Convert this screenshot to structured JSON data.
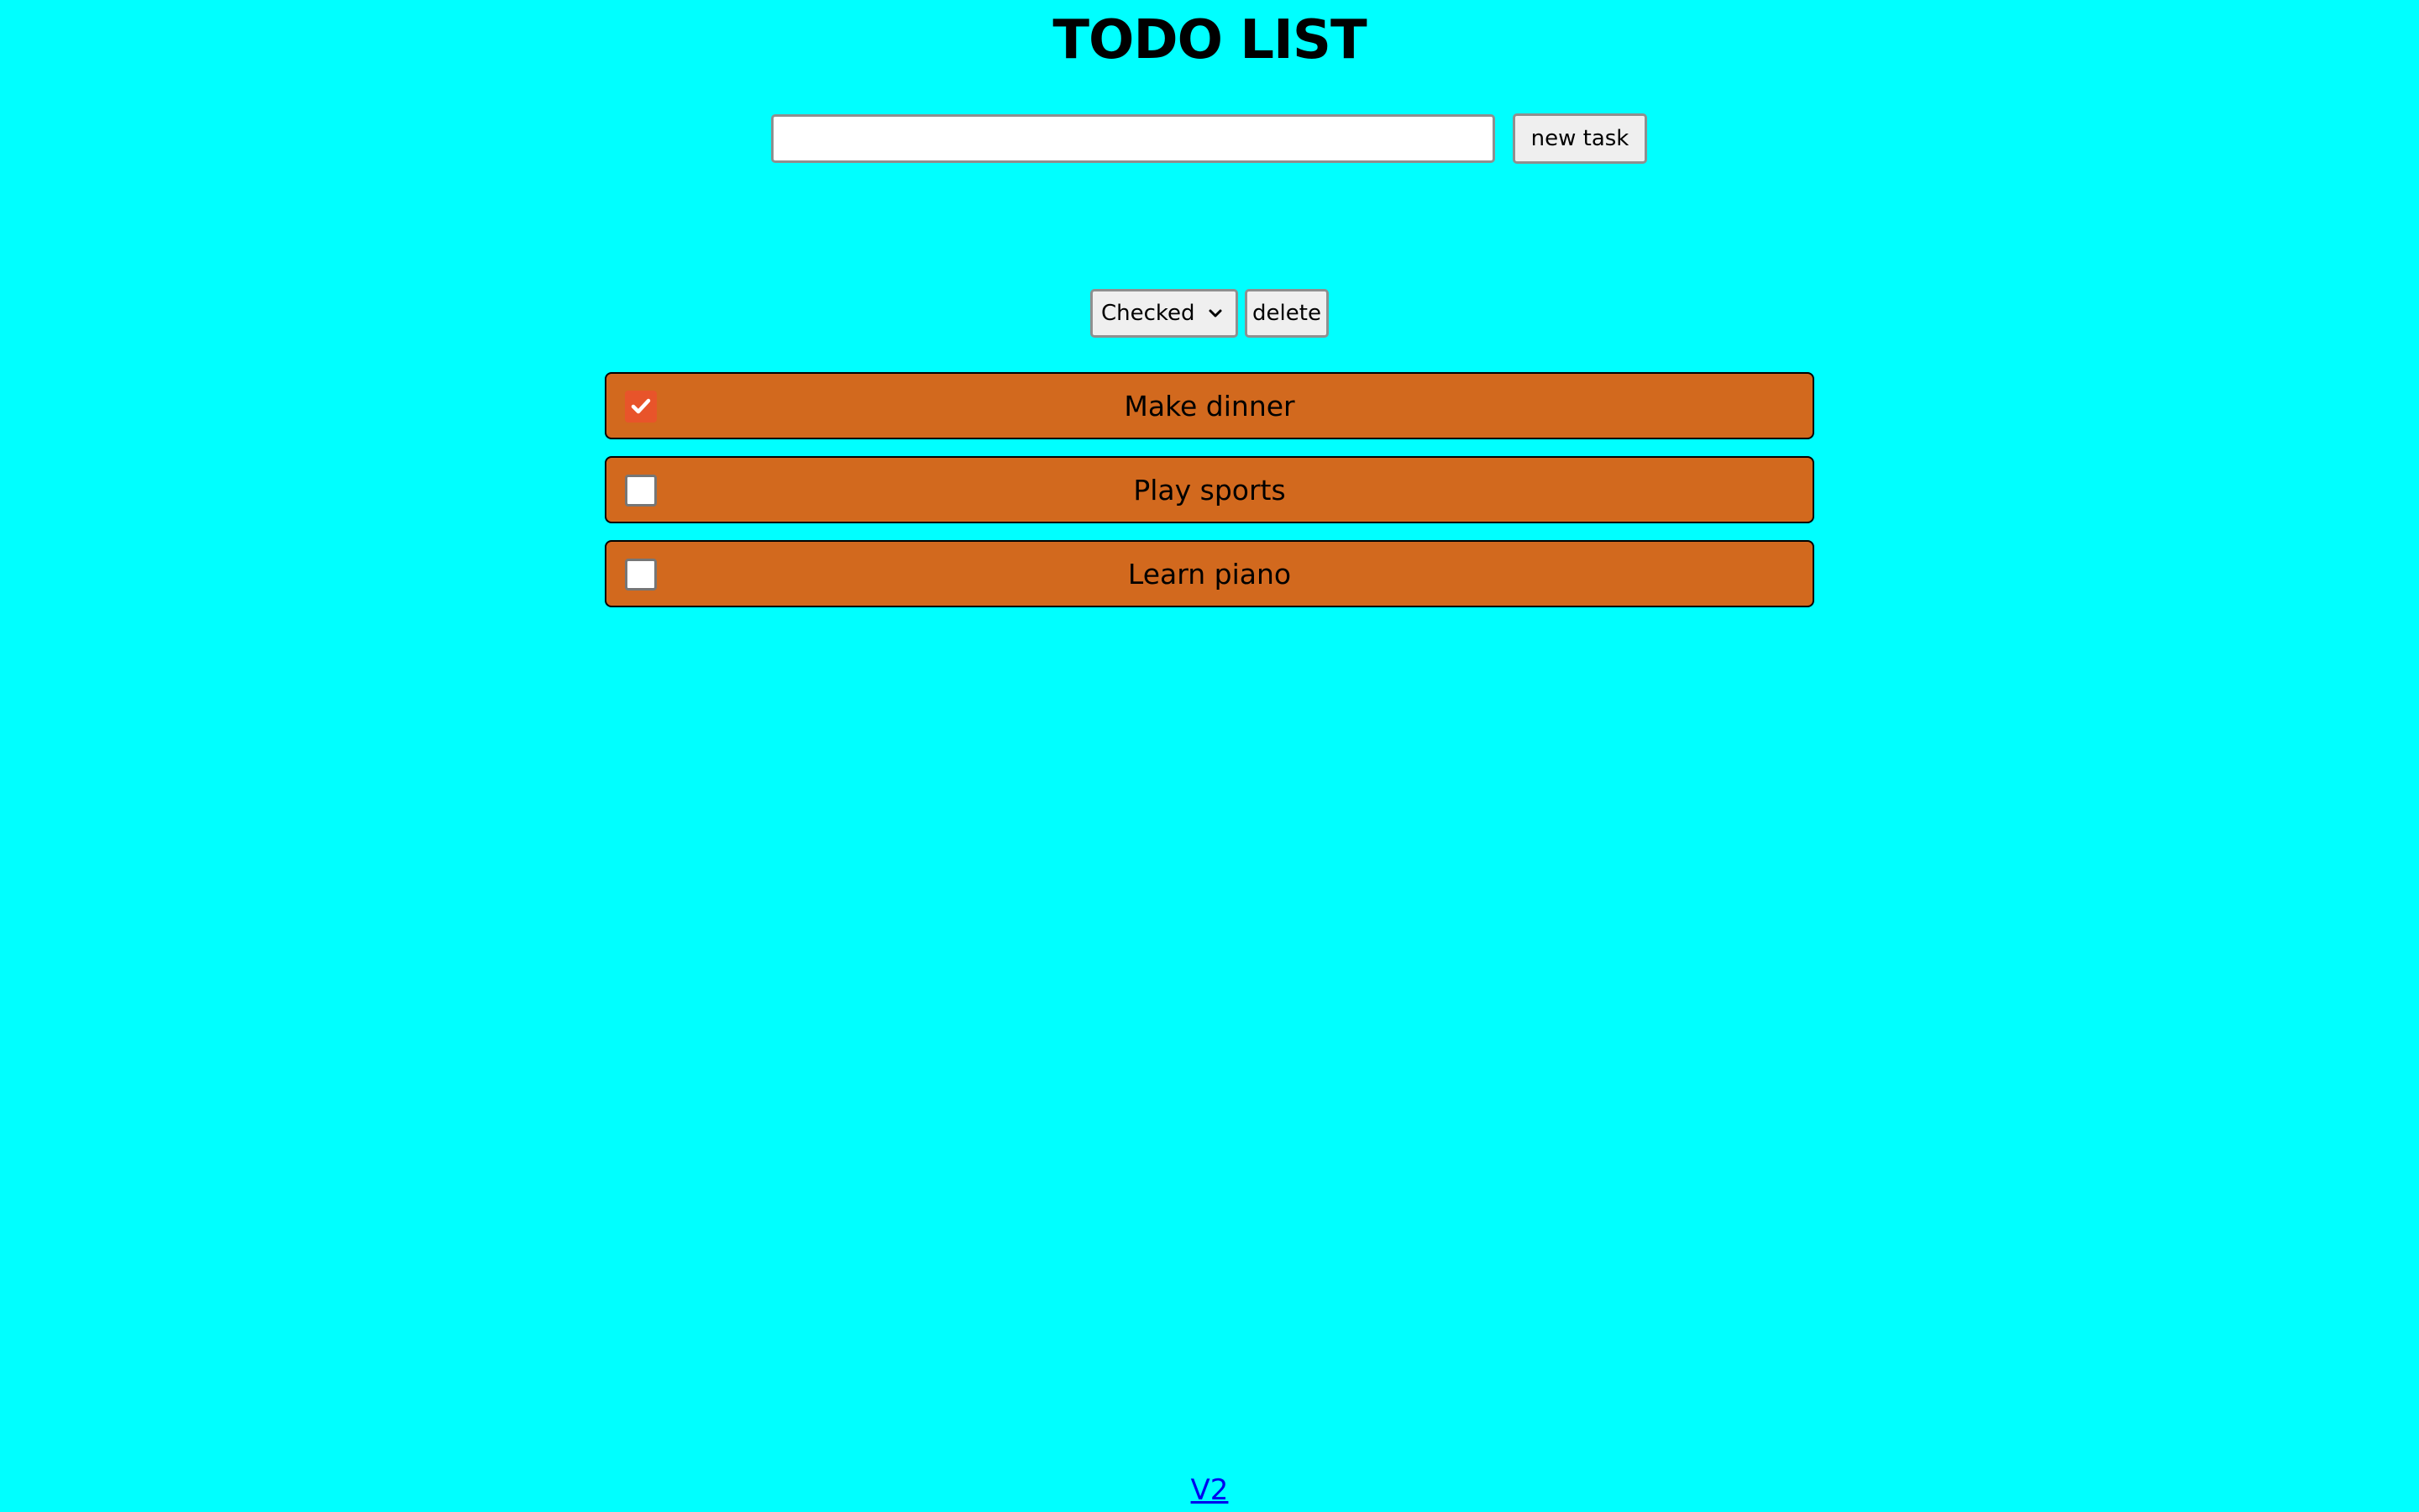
{
  "header": {
    "title": "TODO LIST"
  },
  "task_form": {
    "input_value": "",
    "input_placeholder": "",
    "submit_label": "new task"
  },
  "filter": {
    "selected": "Checked",
    "delete_label": "delete",
    "chevron_icon": "chevron-down-icon"
  },
  "todos": [
    {
      "label": "Make dinner",
      "checked": true
    },
    {
      "label": "Play sports",
      "checked": false
    },
    {
      "label": "Learn piano",
      "checked": false
    }
  ],
  "footer": {
    "link_label": "V2"
  },
  "colors": {
    "background": "#00ffff",
    "item_background": "#d2691e",
    "checkbox_checked": "#e8542a",
    "link": "#0000ee"
  }
}
